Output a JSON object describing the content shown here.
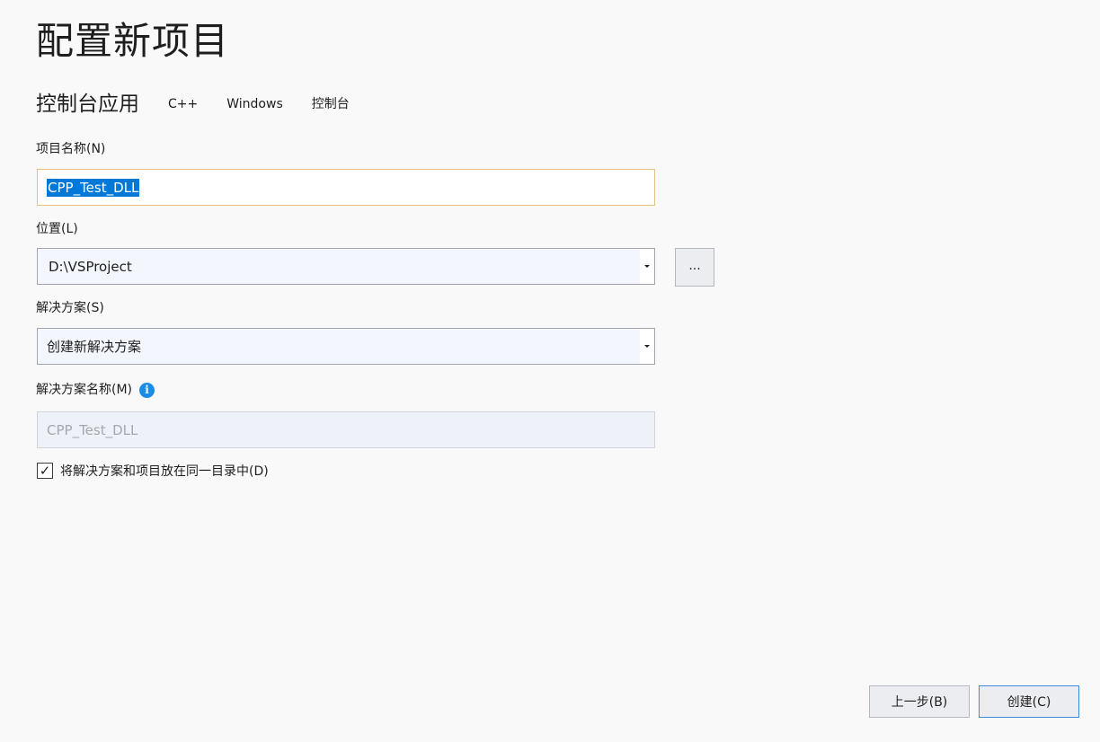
{
  "page": {
    "title": "配置新项目",
    "template_name": "控制台应用",
    "tags": [
      "C++",
      "Windows",
      "控制台"
    ]
  },
  "project_name": {
    "label": "项目名称(N)",
    "value": "CPP_Test_DLL"
  },
  "location": {
    "label": "位置(L)",
    "value": "D:\\VSProject",
    "browse_label": "..."
  },
  "solution": {
    "label": "解决方案(S)",
    "value": "创建新解决方案"
  },
  "solution_name": {
    "label": "解决方案名称(M)",
    "value": "CPP_Test_DLL",
    "info_icon": "i"
  },
  "same_dir": {
    "checked": true,
    "check_glyph": "✓",
    "label": "将解决方案和项目放在同一目录中(D)"
  },
  "footer": {
    "back_label": "上一步(B)",
    "create_label": "创建(C)"
  },
  "colors": {
    "selection": "#0078d7",
    "focus_border": "#e5c27a",
    "info": "#1b8ce6",
    "primary_border": "#3d8ad9"
  }
}
